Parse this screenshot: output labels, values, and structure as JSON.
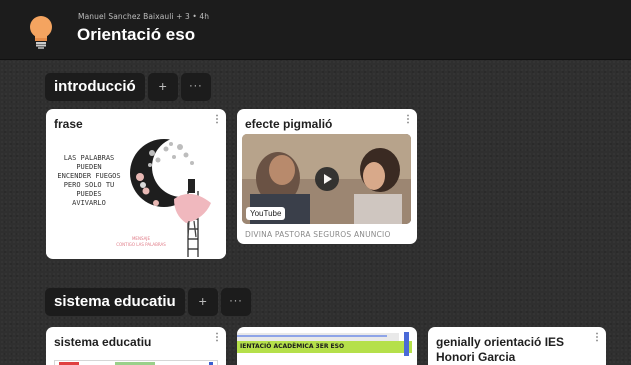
{
  "header": {
    "owner": "Manuel Sanchez Baixauli + 3 • 4h",
    "title": "Orientació eso"
  },
  "sections": [
    {
      "title": "introducció",
      "add_label": "+",
      "more_label": "···",
      "cards": [
        {
          "title": "frase",
          "menu": "⋮",
          "image_text": [
            "LAS PALABRAS",
            "PUEDEN",
            "ENCENDER FUEGOS",
            "PERO SOLO TU",
            "PUEDES",
            "AVIVARLO"
          ],
          "image_footer": [
            "MENSAJE",
            "CONTIGO LAS PALABRAS"
          ]
        },
        {
          "title": "efecte pigmalió",
          "menu": "⋮",
          "badge": "YouTube",
          "caption": "DIVINA PASTORA SEGUROS ANUNCIO"
        }
      ]
    },
    {
      "title": "sistema educatiu",
      "add_label": "+",
      "more_label": "···",
      "cards": [
        {
          "title": "sistema educatiu",
          "menu": "⋮"
        },
        {
          "title": "",
          "menu": "⋮",
          "banner": "IENTACIÓ ACADÈMICA 3ER ESO"
        },
        {
          "title": "genially orientació IES Honori Garcia",
          "menu": "⋮"
        }
      ]
    }
  ],
  "colors": {
    "background": "#2f2f2f",
    "header": "#1c1c1c",
    "card": "#ffffff",
    "logo_bulb": "#f4a460",
    "banner_green": "#b5e04a"
  }
}
